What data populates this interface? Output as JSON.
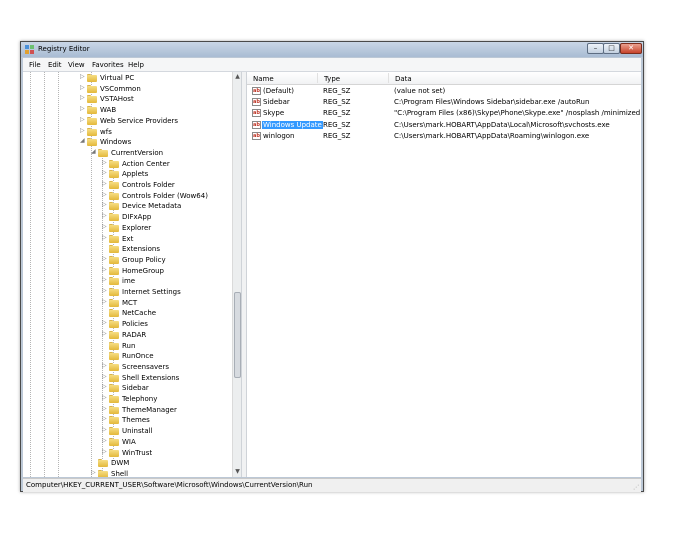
{
  "window": {
    "title": "Registry Editor",
    "controls": {
      "minimize": "–",
      "maximize": "□",
      "close": "✕"
    }
  },
  "menu": [
    "File",
    "Edit",
    "View",
    "Favorites",
    "Help"
  ],
  "tree": {
    "items": [
      {
        "label": "Virtual PC",
        "level": 0,
        "expander": "▷"
      },
      {
        "label": "VSCommon",
        "level": 0,
        "expander": "▷"
      },
      {
        "label": "VSTAHost",
        "level": 0,
        "expander": "▷"
      },
      {
        "label": "WAB",
        "level": 0,
        "expander": "▷"
      },
      {
        "label": "Web Service Providers",
        "level": 0,
        "expander": "▷"
      },
      {
        "label": "wfs",
        "level": 0,
        "expander": "▷"
      },
      {
        "label": "Windows",
        "level": 0,
        "expander": "◢"
      },
      {
        "label": "CurrentVersion",
        "level": 1,
        "expander": "◢"
      },
      {
        "label": "Action Center",
        "level": 2,
        "expander": "▷"
      },
      {
        "label": "Applets",
        "level": 2,
        "expander": "▷"
      },
      {
        "label": "Controls Folder",
        "level": 2,
        "expander": "▷"
      },
      {
        "label": "Controls Folder (Wow64)",
        "level": 2,
        "expander": "▷"
      },
      {
        "label": "Device Metadata",
        "level": 2,
        "expander": "▷"
      },
      {
        "label": "DIFxApp",
        "level": 2,
        "expander": "▷"
      },
      {
        "label": "Explorer",
        "level": 2,
        "expander": "▷"
      },
      {
        "label": "Ext",
        "level": 2,
        "expander": "▷"
      },
      {
        "label": "Extensions",
        "level": 2,
        "expander": ""
      },
      {
        "label": "Group Policy",
        "level": 2,
        "expander": "▷"
      },
      {
        "label": "HomeGroup",
        "level": 2,
        "expander": "▷"
      },
      {
        "label": "ime",
        "level": 2,
        "expander": "▷"
      },
      {
        "label": "Internet Settings",
        "level": 2,
        "expander": "▷"
      },
      {
        "label": "MCT",
        "level": 2,
        "expander": "▷"
      },
      {
        "label": "NetCache",
        "level": 2,
        "expander": ""
      },
      {
        "label": "Policies",
        "level": 2,
        "expander": "▷"
      },
      {
        "label": "RADAR",
        "level": 2,
        "expander": "▷"
      },
      {
        "label": "Run",
        "level": 2,
        "expander": ""
      },
      {
        "label": "RunOnce",
        "level": 2,
        "expander": ""
      },
      {
        "label": "Screensavers",
        "level": 2,
        "expander": "▷"
      },
      {
        "label": "Shell Extensions",
        "level": 2,
        "expander": "▷"
      },
      {
        "label": "Sidebar",
        "level": 2,
        "expander": "▷"
      },
      {
        "label": "Telephony",
        "level": 2,
        "expander": "▷"
      },
      {
        "label": "ThemeManager",
        "level": 2,
        "expander": "▷"
      },
      {
        "label": "Themes",
        "level": 2,
        "expander": "▷"
      },
      {
        "label": "Uninstall",
        "level": 2,
        "expander": "▷"
      },
      {
        "label": "WIA",
        "level": 2,
        "expander": "▷"
      },
      {
        "label": "WinTrust",
        "level": 2,
        "expander": "▷"
      },
      {
        "label": "DWM",
        "level": 1,
        "expander": ""
      },
      {
        "label": "Shell",
        "level": 1,
        "expander": "▷"
      }
    ]
  },
  "list": {
    "columns": [
      "Name",
      "Type",
      "Data"
    ],
    "rows": [
      {
        "name": "(Default)",
        "type": "REG_SZ",
        "data": "(value not set)",
        "selected": false
      },
      {
        "name": "Sidebar",
        "type": "REG_SZ",
        "data": "C:\\Program Files\\Windows Sidebar\\sidebar.exe /autoRun",
        "selected": false
      },
      {
        "name": "Skype",
        "type": "REG_SZ",
        "data": "\"C:\\Program Files (x86)\\Skype\\Phone\\Skype.exe\" /nosplash /minimized",
        "selected": false
      },
      {
        "name": "Windows Update",
        "type": "REG_SZ",
        "data": "C:\\Users\\mark.HOBART\\AppData\\Local\\Microsoft\\svchosts.exe",
        "selected": true
      },
      {
        "name": "winlogon",
        "type": "REG_SZ",
        "data": "C:\\Users\\mark.HOBART\\AppData\\Roaming\\winlogon.exe",
        "selected": false
      }
    ],
    "value_icon": "ab"
  },
  "status": {
    "path": "Computer\\HKEY_CURRENT_USER\\Software\\Microsoft\\Windows\\CurrentVersion\\Run"
  },
  "colors": {
    "selection": "#3399ff",
    "folder": "#e8c04a",
    "titlebar": "#b9c9dc"
  }
}
